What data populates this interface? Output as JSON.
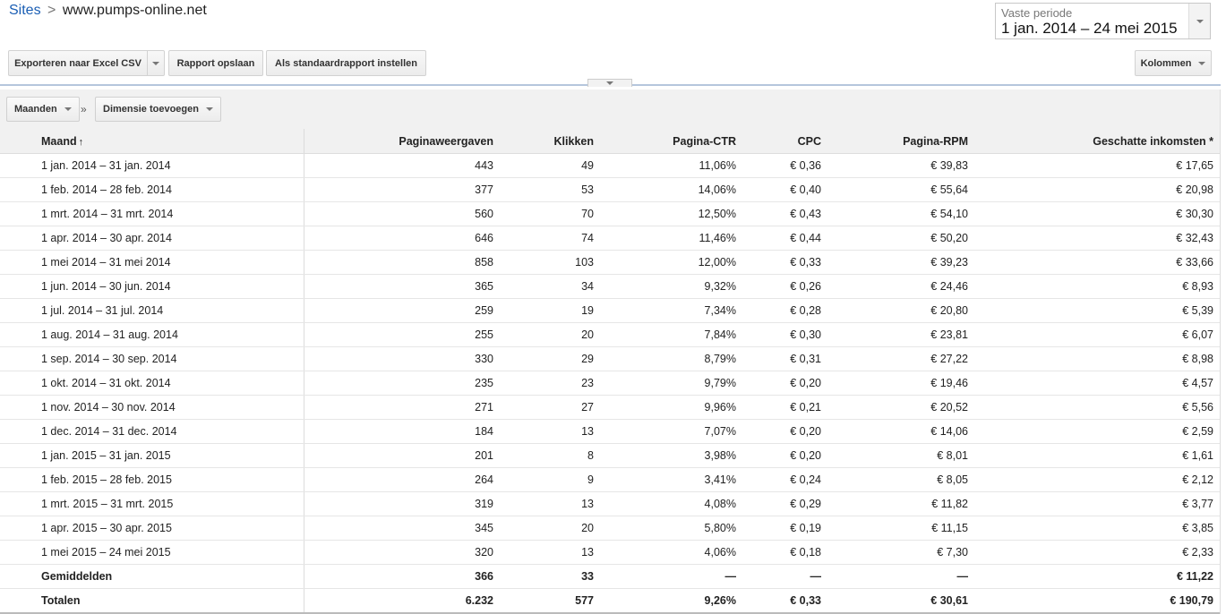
{
  "breadcrumb": {
    "root": "Sites",
    "separator": ">",
    "current": "www.pumps-online.net"
  },
  "period": {
    "label": "Vaste periode",
    "value": "1 jan. 2014 – 24 mei 2015"
  },
  "toolbar": {
    "export_label": "Exporteren naar Excel CSV",
    "save_label": "Rapport opslaan",
    "default_label": "Als standaardrapport instellen",
    "columns_label": "Kolommen"
  },
  "dimensions": {
    "primary": "Maanden",
    "separator": "»",
    "add": "Dimensie toevoegen"
  },
  "table": {
    "sort_indicator": "↑",
    "headers": [
      "Maand",
      "Paginaweergaven",
      "Klikken",
      "Pagina-CTR",
      "CPC",
      "Pagina-RPM",
      "Geschatte inkomsten *"
    ],
    "rows": [
      [
        "1 jan. 2014 – 31 jan. 2014",
        "443",
        "49",
        "11,06%",
        "€ 0,36",
        "€ 39,83",
        "€ 17,65"
      ],
      [
        "1 feb. 2014 – 28 feb. 2014",
        "377",
        "53",
        "14,06%",
        "€ 0,40",
        "€ 55,64",
        "€ 20,98"
      ],
      [
        "1 mrt. 2014 – 31 mrt. 2014",
        "560",
        "70",
        "12,50%",
        "€ 0,43",
        "€ 54,10",
        "€ 30,30"
      ],
      [
        "1 apr. 2014 – 30 apr. 2014",
        "646",
        "74",
        "11,46%",
        "€ 0,44",
        "€ 50,20",
        "€ 32,43"
      ],
      [
        "1 mei 2014 – 31 mei 2014",
        "858",
        "103",
        "12,00%",
        "€ 0,33",
        "€ 39,23",
        "€ 33,66"
      ],
      [
        "1 jun. 2014 – 30 jun. 2014",
        "365",
        "34",
        "9,32%",
        "€ 0,26",
        "€ 24,46",
        "€ 8,93"
      ],
      [
        "1 jul. 2014 – 31 jul. 2014",
        "259",
        "19",
        "7,34%",
        "€ 0,28",
        "€ 20,80",
        "€ 5,39"
      ],
      [
        "1 aug. 2014 – 31 aug. 2014",
        "255",
        "20",
        "7,84%",
        "€ 0,30",
        "€ 23,81",
        "€ 6,07"
      ],
      [
        "1 sep. 2014 – 30 sep. 2014",
        "330",
        "29",
        "8,79%",
        "€ 0,31",
        "€ 27,22",
        "€ 8,98"
      ],
      [
        "1 okt. 2014 – 31 okt. 2014",
        "235",
        "23",
        "9,79%",
        "€ 0,20",
        "€ 19,46",
        "€ 4,57"
      ],
      [
        "1 nov. 2014 – 30 nov. 2014",
        "271",
        "27",
        "9,96%",
        "€ 0,21",
        "€ 20,52",
        "€ 5,56"
      ],
      [
        "1 dec. 2014 – 31 dec. 2014",
        "184",
        "13",
        "7,07%",
        "€ 0,20",
        "€ 14,06",
        "€ 2,59"
      ],
      [
        "1 jan. 2015 – 31 jan. 2015",
        "201",
        "8",
        "3,98%",
        "€ 0,20",
        "€ 8,01",
        "€ 1,61"
      ],
      [
        "1 feb. 2015 – 28 feb. 2015",
        "264",
        "9",
        "3,41%",
        "€ 0,24",
        "€ 8,05",
        "€ 2,12"
      ],
      [
        "1 mrt. 2015 – 31 mrt. 2015",
        "319",
        "13",
        "4,08%",
        "€ 0,29",
        "€ 11,82",
        "€ 3,77"
      ],
      [
        "1 apr. 2015 – 30 apr. 2015",
        "345",
        "20",
        "5,80%",
        "€ 0,19",
        "€ 11,15",
        "€ 3,85"
      ],
      [
        "1 mei 2015 – 24 mei 2015",
        "320",
        "13",
        "4,06%",
        "€ 0,18",
        "€ 7,30",
        "€ 2,33"
      ]
    ],
    "averages": [
      "Gemiddelden",
      "366",
      "33",
      "—",
      "—",
      "—",
      "€ 11,22"
    ],
    "totals": [
      "Totalen",
      "6.232",
      "577",
      "9,26%",
      "€ 0,33",
      "€ 30,61",
      "€ 190,79"
    ]
  }
}
